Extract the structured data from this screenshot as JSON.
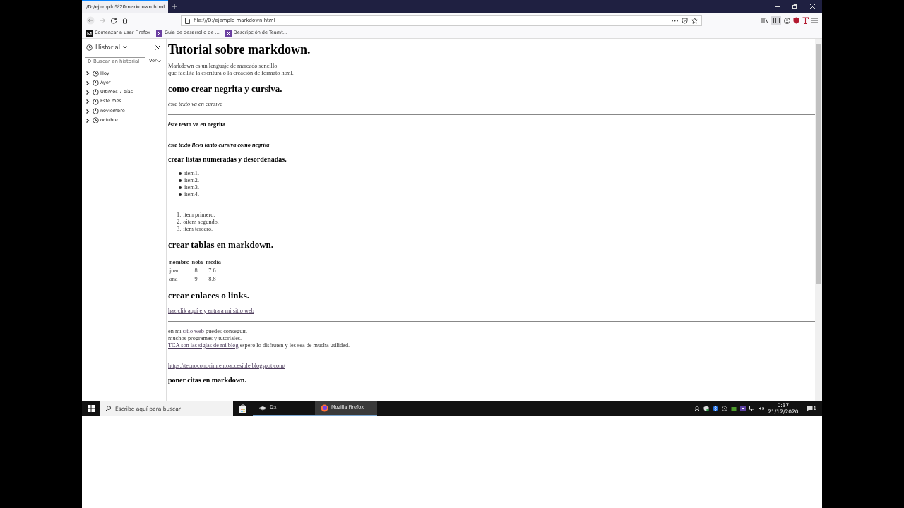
{
  "browser": {
    "tab": {
      "title": "/D:/ejemplo%20markdown.html",
      "selected": true
    },
    "url": "file:///D:/ejemplo markdown.html",
    "sidebar_button": {
      "active": true
    },
    "bookmarks": [
      {
        "label": "Comenzar a usar Firefox",
        "kind": "mdn"
      },
      {
        "label": "Guía de desarrollo de ...",
        "kind": "teamwork"
      },
      {
        "label": "Descripción de Teamt...",
        "kind": "teamwork"
      }
    ]
  },
  "sidebar": {
    "title": "Historial",
    "search": {
      "placeholder": "Buscar en historial"
    },
    "view_button": "Ver",
    "items": [
      {
        "label": "Hoy",
        "expanded": false
      },
      {
        "label": "Ayer",
        "expanded": false
      },
      {
        "label": "Últimos 7 días",
        "expanded": false
      },
      {
        "label": "Este mes",
        "expanded": false
      },
      {
        "label": "noviembre",
        "expanded": false
      },
      {
        "label": "octubre",
        "expanded": false
      }
    ]
  },
  "page": {
    "blocks": [
      {
        "kind": "h1",
        "text": "Tutorial sobre markdown."
      },
      {
        "kind": "p",
        "lines": [
          "Markdown es un lenguaje de marcado sencillo",
          "que facilita la escritura o la creación de formato html."
        ]
      },
      {
        "kind": "h2",
        "text": "como crear negrita y cursiva."
      },
      {
        "kind": "em",
        "text": "éste texto va en cursiva"
      },
      {
        "kind": "hr"
      },
      {
        "kind": "strong",
        "text": "éste texto va en negrita"
      },
      {
        "kind": "hr"
      },
      {
        "kind": "strong-em",
        "text": "éste texto lleva tanto cursiva como negrita"
      },
      {
        "kind": "h3",
        "text": "crear listas numeradas y desordenadas."
      },
      {
        "kind": "ul",
        "items": [
          "item1.",
          "item2.",
          "item3.",
          "item4."
        ]
      },
      {
        "kind": "hr"
      },
      {
        "kind": "ol",
        "items": [
          {
            "number": "1.",
            "text": "item primero."
          },
          {
            "number": "2.",
            "text": "oitem segundo."
          },
          {
            "number": "3.",
            "text": "item tercero."
          }
        ]
      },
      {
        "kind": "h2",
        "text": "crear tablas en markdown."
      },
      {
        "kind": "table",
        "columns": [
          "nombre",
          "nota",
          "media"
        ],
        "rows": [
          [
            "juan",
            "8",
            "7.6"
          ],
          [
            "ana",
            "9",
            "8.8"
          ]
        ]
      },
      {
        "kind": "h2",
        "text": "crear enlaces o links."
      },
      {
        "kind": "lines",
        "lines": [
          [
            {
              "text": "haz clik aquí e y entra a mi sitio web",
              "link": true
            }
          ]
        ]
      },
      {
        "kind": "hr"
      },
      {
        "kind": "lines",
        "lines": [
          [
            {
              "text": "en mi ",
              "link": false
            },
            {
              "text": "sitio web",
              "link": true
            },
            {
              "text": " puedes conseguir.",
              "link": false
            }
          ],
          [
            {
              "text": "muchos programas y tutoriales.",
              "link": false
            }
          ],
          [
            {
              "text": "TCA son las siglas de mi blog",
              "link": true
            },
            {
              "text": " espero lo disfruten y les sea de mucha utilidad.",
              "link": false
            }
          ]
        ]
      },
      {
        "kind": "hr"
      },
      {
        "kind": "lines",
        "lines": [
          [
            {
              "text": "https://tecnoconocimientoaccesible.blogspot.com/",
              "link": true
            }
          ]
        ]
      },
      {
        "kind": "h3",
        "text": "poner citas en markdown."
      }
    ]
  },
  "taskbar": {
    "search": {
      "placeholder": "Escribe aquí para buscar"
    },
    "apps": [
      {
        "label": "D:\\",
        "kind": "drive",
        "selected": false
      },
      {
        "label": "Mozilla Firefox",
        "kind": "firefox",
        "selected": true
      }
    ],
    "time": "0:37",
    "date": "21/12/2020",
    "notification_count": "1"
  }
}
